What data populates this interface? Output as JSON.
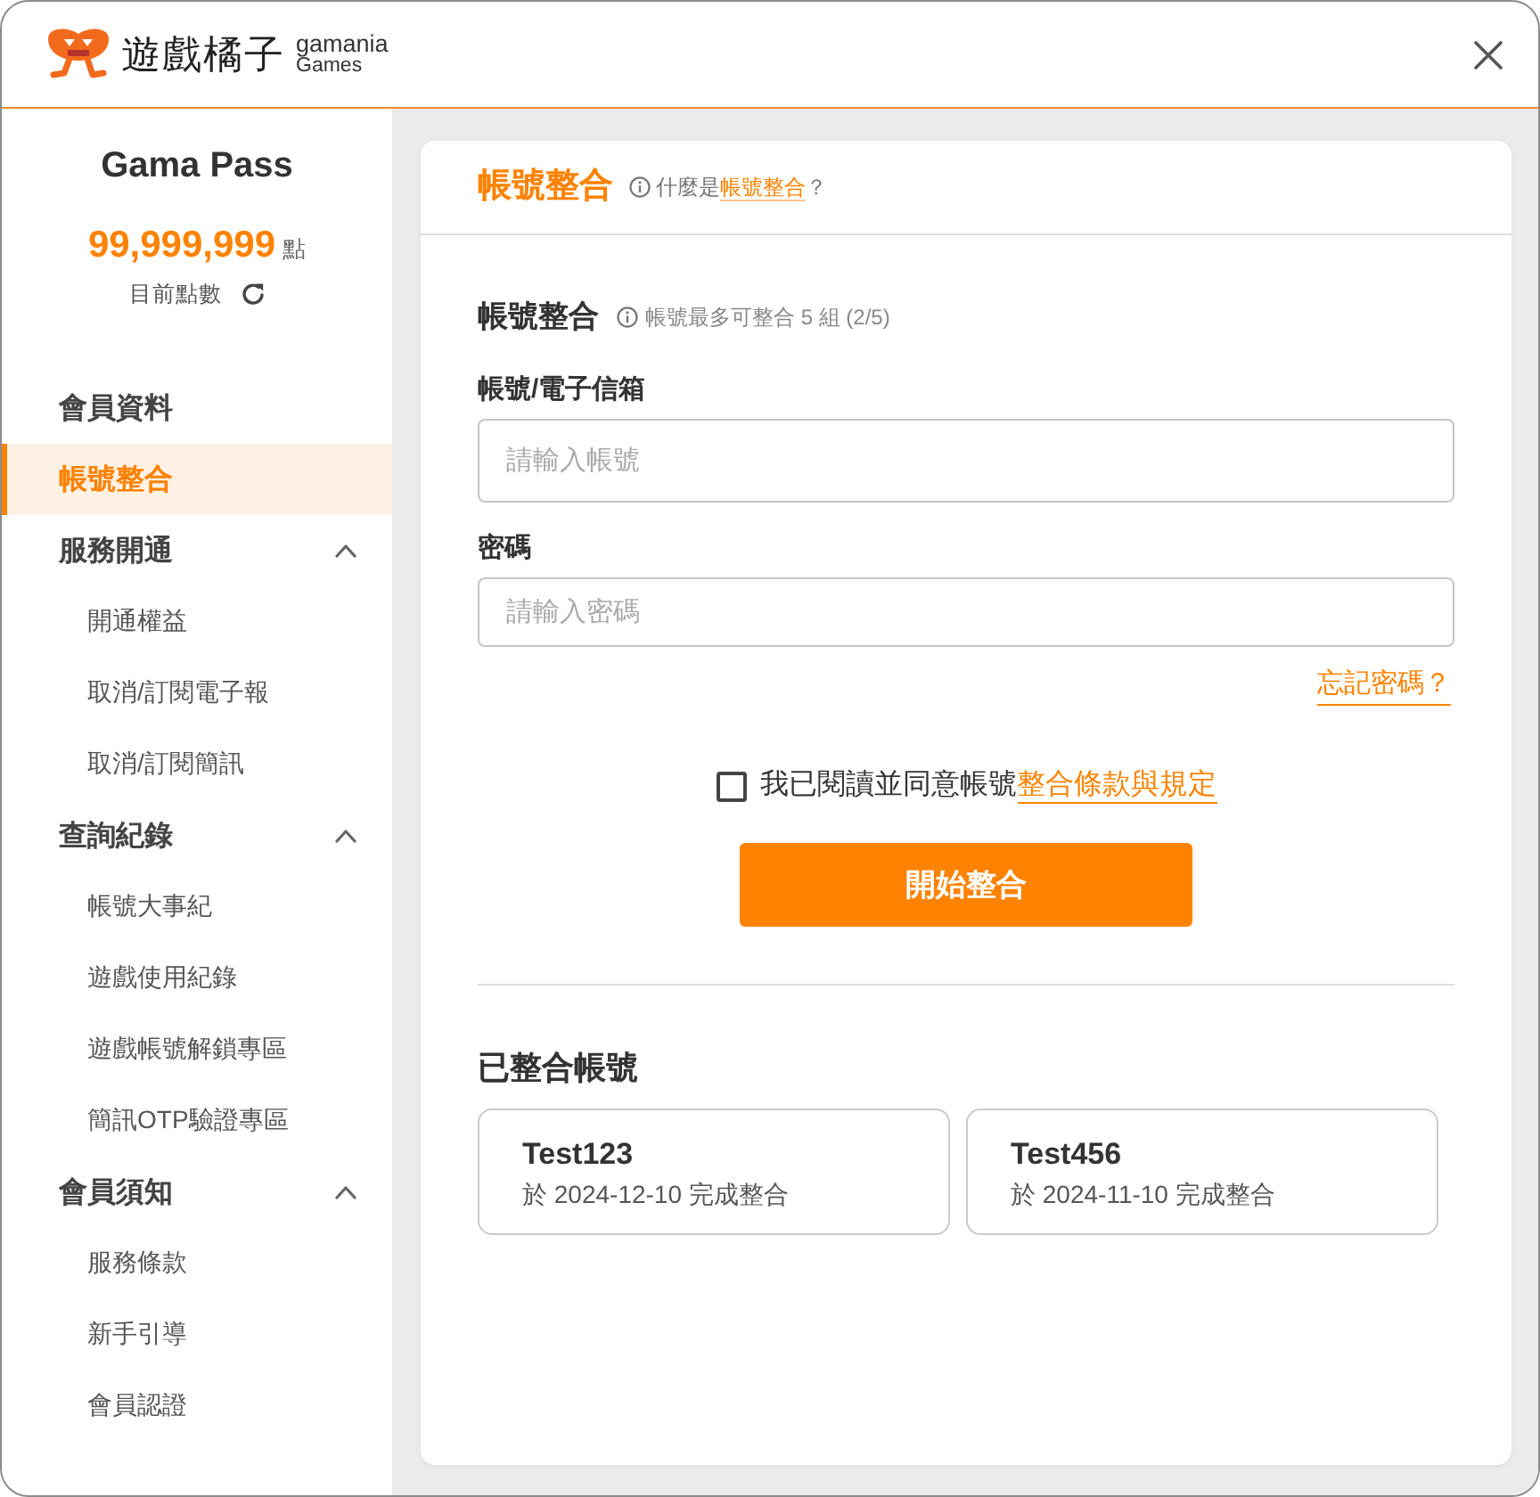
{
  "header": {
    "brand_name": "遊戲橘子",
    "brand_line_1": "gamania",
    "brand_line_2": "Games"
  },
  "sidebar": {
    "title": "Gama Pass",
    "points": "99,999,999",
    "points_unit": "點",
    "points_label": "目前點數",
    "items": [
      {
        "kind": "link",
        "label": "會員資料",
        "selected": false
      },
      {
        "kind": "link",
        "label": "帳號整合",
        "selected": true
      },
      {
        "kind": "group",
        "label": "服務開通",
        "selected": false,
        "expanded": true,
        "children": [
          {
            "label": "開通權益",
            "selected": false
          },
          {
            "label": "取消/訂閱電子報",
            "selected": false
          },
          {
            "label": "取消/訂閱簡訊",
            "selected": false
          }
        ]
      },
      {
        "kind": "group",
        "label": "查詢紀錄",
        "selected": false,
        "expanded": true,
        "children": [
          {
            "label": "帳號大事紀",
            "selected": false
          },
          {
            "label": "遊戲使用紀錄",
            "selected": false
          },
          {
            "label": "遊戲帳號解鎖專區",
            "selected": false
          },
          {
            "label": "簡訊OTP驗證專區",
            "selected": false
          }
        ]
      },
      {
        "kind": "group",
        "label": "會員須知",
        "selected": false,
        "expanded": true,
        "children": [
          {
            "label": "服務條款",
            "selected": false
          },
          {
            "label": "新手引導",
            "selected": false
          },
          {
            "label": "會員認證",
            "selected": false
          }
        ]
      }
    ]
  },
  "content": {
    "title": "帳號整合",
    "help_prefix": "什麼是",
    "help_link": "帳號整合",
    "help_suffix": "？",
    "form": {
      "title": "帳號整合",
      "note": "帳號最多可整合 5 組 (2/5)",
      "fields": [
        {
          "label": "帳號/電子信箱",
          "placeholder": "請輸入帳號"
        },
        {
          "label": "密碼",
          "placeholder": "請輸入密碼"
        }
      ],
      "forgot_link": "忘記密碼？",
      "agree": {
        "checked": false,
        "text": "我已閱讀並同意帳號",
        "link": "整合條款與規定"
      },
      "submit": "開始整合"
    },
    "linked": {
      "title": "已整合帳號",
      "accounts": [
        {
          "name": "Test123",
          "note": "於 2024-12-10 完成整合"
        },
        {
          "name": "Test456",
          "note": "於 2024-11-10 完成整合"
        }
      ]
    }
  }
}
